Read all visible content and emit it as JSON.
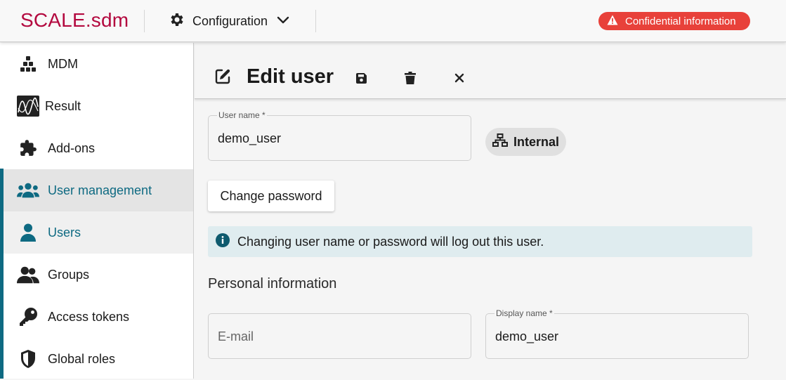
{
  "header": {
    "logo": "SCALE.sdm",
    "config_label": "Configuration",
    "badge_text": "Confidential information",
    "badge_color": "#e8413a",
    "brand_color": "#b3093f"
  },
  "sidebar": {
    "accent_color": "#0e6a82",
    "items": [
      {
        "label": "MDM",
        "icon": "hierarchy-icon"
      },
      {
        "label": "Result",
        "icon": "result-chart-icon"
      },
      {
        "label": "Add-ons",
        "icon": "puzzle-icon"
      },
      {
        "label": "User management",
        "icon": "users-group-icon"
      },
      {
        "label": "Users",
        "icon": "user-icon"
      },
      {
        "label": "Groups",
        "icon": "groups-icon"
      },
      {
        "label": "Access tokens",
        "icon": "key-icon"
      },
      {
        "label": "Global roles",
        "icon": "shield-icon"
      }
    ]
  },
  "main": {
    "title": "Edit user",
    "username": {
      "label": "User name *",
      "value": "demo_user"
    },
    "chip_label": "Internal",
    "change_password_label": "Change password",
    "info_text": "Changing user name or password will log out this user.",
    "section_title": "Personal information",
    "email": {
      "placeholder": "E-mail",
      "value": ""
    },
    "display_name": {
      "label": "Display name *",
      "value": "demo_user"
    }
  }
}
